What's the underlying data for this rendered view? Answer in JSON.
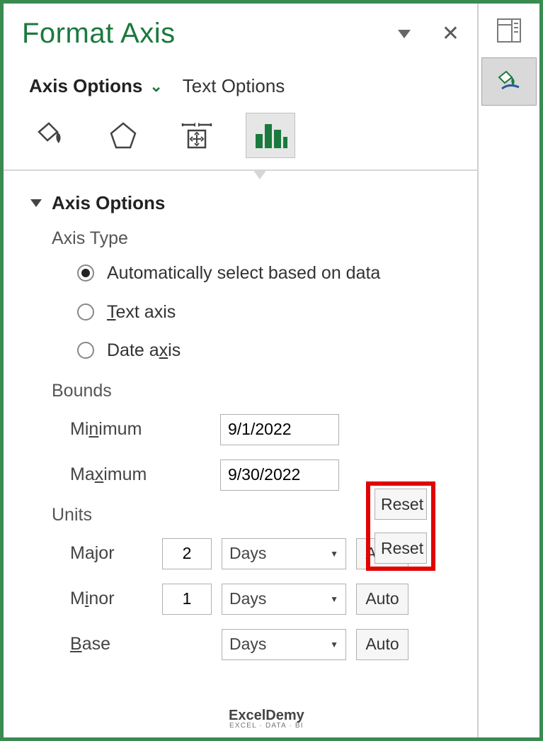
{
  "panel": {
    "title": "Format Axis",
    "tabs": {
      "axis_options": "Axis Options",
      "text_options": "Text Options"
    }
  },
  "section": {
    "title": "Axis Options",
    "axis_type_label": "Axis Type",
    "radios": {
      "auto": "Automatically select based on data",
      "text": "Text axis",
      "date": "Date axis"
    },
    "selected_radio": "auto"
  },
  "bounds": {
    "title": "Bounds",
    "minimum_label": "Minimum",
    "maximum_label": "Maximum",
    "minimum_value": "9/1/2022",
    "maximum_value": "9/30/2022",
    "reset_label_min": "Reset",
    "reset_label_max": "Reset"
  },
  "units": {
    "title": "Units",
    "major_label": "Major",
    "minor_label": "Minor",
    "base_label": "Base",
    "major_value": "2",
    "minor_value": "1",
    "major_unit": "Days",
    "minor_unit": "Days",
    "base_unit": "Days",
    "auto_label_major": "Auto",
    "auto_label_minor": "Auto",
    "auto_label_base": "Auto"
  },
  "watermark": {
    "line1": "ExcelDemy",
    "line2": "EXCEL · DATA · BI"
  },
  "icons": {
    "side_table": "table-with-pane-icon",
    "side_format": "paint-bucket-brush-icon",
    "fill_line": "paint-bucket-icon",
    "effects": "pentagon-effects-icon",
    "size": "size-properties-icon",
    "axis": "column-chart-icon"
  },
  "colors": {
    "accent": "#1a7a3d",
    "highlight_border": "#e20000"
  }
}
